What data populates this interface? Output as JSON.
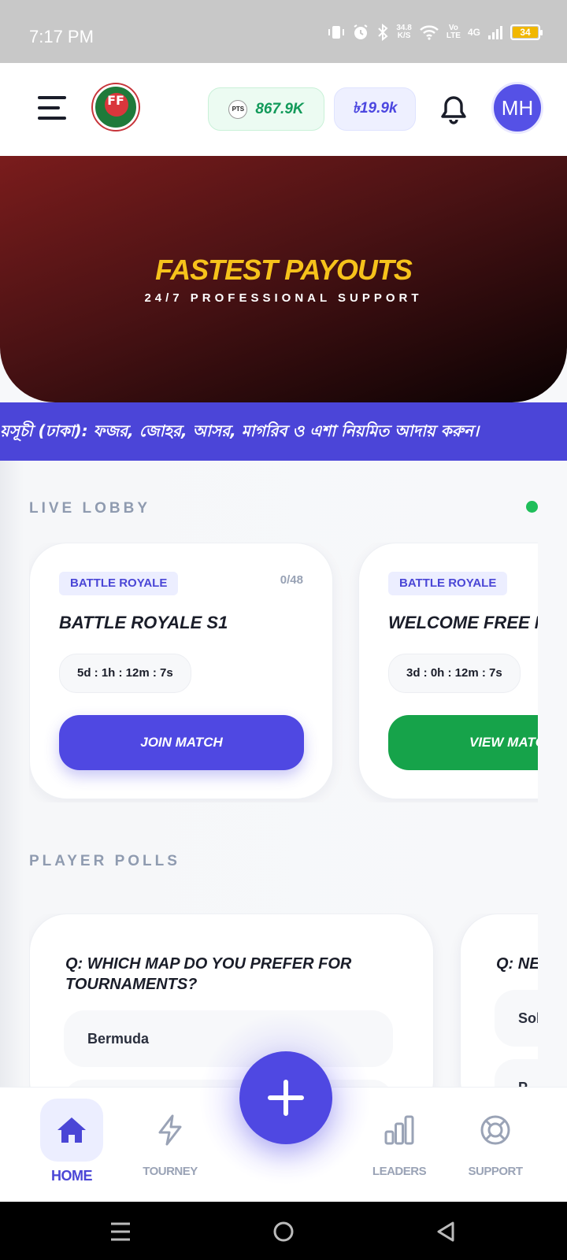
{
  "status_bar": {
    "time": "7:17 PM",
    "net_speed_value": "34.8",
    "net_speed_unit": "K/S",
    "volte_top": "Vo",
    "volte_bottom": "LTE",
    "network": "4G",
    "battery": "34"
  },
  "header": {
    "logo_text": "FF",
    "points_icon_text": "PTS",
    "points": "867.9K",
    "balance": "৳19.9k",
    "avatar_initials": "MH"
  },
  "banner": {
    "title": "FASTEST PAYOUTS",
    "subtitle": "24/7 PROFESSIONAL SUPPORT"
  },
  "marquee": {
    "text": "য়সূচী (ঢাকা): ফজর, জোহর, আসর, মাগরিব ও এশা নিয়মিত আদায় করুন।"
  },
  "live_lobby": {
    "title": "LIVE LOBBY",
    "status_color": "#1fbe5a",
    "matches": [
      {
        "tag": "BATTLE ROYALE",
        "slots": "0/48",
        "name": "BATTLE ROYALE S1",
        "timer": "5d : 1h : 12m : 7s",
        "cta": "JOIN MATCH"
      },
      {
        "tag": "BATTLE ROYALE",
        "slots": "",
        "name": "WELCOME FREE M",
        "timer": "3d : 0h : 12m : 7s",
        "cta": "VIEW MATC"
      }
    ]
  },
  "player_polls": {
    "title": "PLAYER POLLS",
    "polls": [
      {
        "question": "Q: WHICH MAP DO YOU PREFER FOR TOURNAMENTS?",
        "options": [
          "Bermuda",
          ""
        ]
      },
      {
        "question": "Q: NE",
        "options": [
          "Sol",
          "P"
        ]
      }
    ]
  },
  "bottom_nav": {
    "items": [
      {
        "label": "HOME",
        "icon": "home-icon",
        "active": true
      },
      {
        "label": "TOURNEY",
        "icon": "bolt-icon",
        "active": false
      },
      {
        "label": "LEADERS",
        "icon": "bar-chart-icon",
        "active": false
      },
      {
        "label": "SUPPORT",
        "icon": "lifebuoy-icon",
        "active": false
      }
    ],
    "fab_icon": "plus-icon"
  },
  "colors": {
    "accent": "#4f48e2",
    "success": "#16a34a",
    "banner_title": "#f6c21b"
  }
}
